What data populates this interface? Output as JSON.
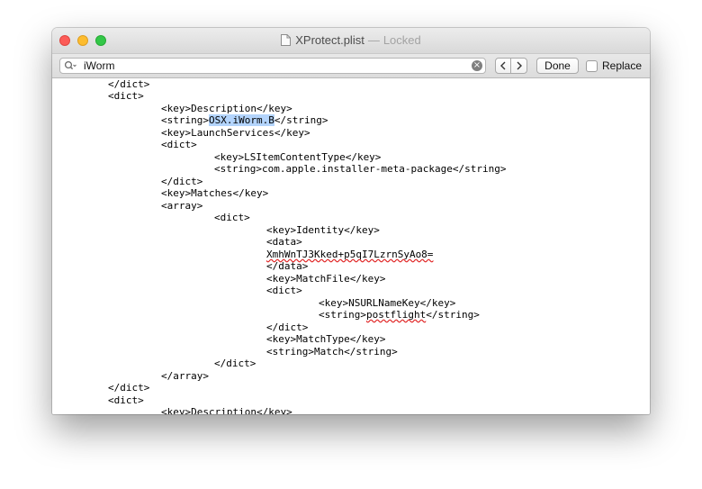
{
  "window": {
    "file_name": "XProtect.plist",
    "separator": "—",
    "status": "Locked"
  },
  "find": {
    "query": "iWorm",
    "done_label": "Done",
    "replace_label": "Replace"
  },
  "code": {
    "lines": [
      {
        "segments": [
          "</dict>"
        ]
      },
      {
        "segments": [
          "<dict>"
        ]
      },
      {
        "segments": [
          "<key>Description</key>"
        ]
      },
      {
        "segments": [
          "<string>",
          "OSX.iWorm.B",
          "</string>"
        ]
      },
      {
        "segments": [
          "<key>LaunchServices</key>"
        ]
      },
      {
        "segments": [
          "<dict>"
        ]
      },
      {
        "segments": [
          "<key>LSItemContentType</key>"
        ]
      },
      {
        "segments": [
          "<string>com.apple.installer-meta-package</string>"
        ]
      },
      {
        "segments": [
          "</dict>"
        ]
      },
      {
        "segments": [
          "<key>Matches</key>"
        ]
      },
      {
        "segments": [
          "<array>"
        ]
      },
      {
        "segments": [
          "<dict>"
        ]
      },
      {
        "segments": [
          "<key>Identity</key>"
        ]
      },
      {
        "segments": [
          "<data>"
        ]
      },
      {
        "segments": [
          "XmhWnTJ3Kked+p5qI7LzrnSyAo8="
        ]
      },
      {
        "segments": [
          "</data>"
        ]
      },
      {
        "segments": [
          "<key>MatchFile</key>"
        ]
      },
      {
        "segments": [
          "<dict>"
        ]
      },
      {
        "segments": [
          "<key>NSURLNameKey</key>"
        ]
      },
      {
        "segments": [
          "<string>",
          "postflight",
          "</string>"
        ]
      },
      {
        "segments": [
          "</dict>"
        ]
      },
      {
        "segments": [
          "<key>MatchType</key>"
        ]
      },
      {
        "segments": [
          "<string>Match</string>"
        ]
      },
      {
        "segments": [
          "</dict>"
        ]
      },
      {
        "segments": [
          "</array>"
        ]
      },
      {
        "segments": [
          "</dict>"
        ]
      },
      {
        "segments": [
          "<dict>"
        ]
      },
      {
        "segments": [
          "<key>Description</key>"
        ]
      }
    ]
  }
}
